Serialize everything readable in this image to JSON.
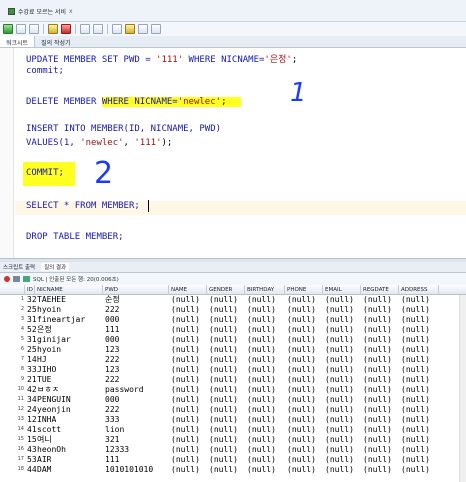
{
  "window": {
    "tab_title": "수강료 모르는 서비",
    "tab_close": "x"
  },
  "subtabs": [
    "워크시트",
    "질의 작성기"
  ],
  "editor": {
    "lines": {
      "update_kw": "UPDATE MEMBER SET PWD = ",
      "update_val": "'111'",
      "update_where": " WHERE NICNAME=",
      "update_nick": "'은정'",
      "update_end": ";",
      "commit1": "commit;",
      "delete_kw": "DELETE MEMBER ",
      "delete_where": "WHERE NICNAME=",
      "delete_val": "'newlec'",
      "delete_end": ";",
      "insert1": "INSERT INTO MEMBER(ID, NICNAME, PWD)",
      "insert2_kw": "VALUES(1, ",
      "insert2_a": "'newlec'",
      "insert2_b": ", ",
      "insert2_c": "'111'",
      "insert2_end": ");",
      "commit2": "COMMIT;",
      "select": "SELECT * FROM MEMBER;",
      "drop": "DROP TABLE MEMBER;"
    },
    "annotations": {
      "one": "1",
      "two": "2"
    }
  },
  "results": {
    "tabs": [
      "스크립트 출력",
      "질의 결과"
    ],
    "status": "SQL | 인출된 모든 행: 20(0.006초)",
    "columns": [
      "ID",
      "NICNAME",
      "PWD",
      "NAME",
      "GENDER",
      "BIRTHDAY",
      "PHONE",
      "EMAIL",
      "REGDATE",
      "ADDRESS"
    ],
    "rows": [
      {
        "n": "1",
        "id": "32",
        "nick": "TAEHEE",
        "pwd": "순정"
      },
      {
        "n": "2",
        "id": "25",
        "nick": "hyoin",
        "pwd": "222"
      },
      {
        "n": "3",
        "id": "31",
        "nick": "fineartjar",
        "pwd": "000"
      },
      {
        "n": "4",
        "id": "52",
        "nick": "은정",
        "pwd": "111"
      },
      {
        "n": "5",
        "id": "31",
        "nick": "ginijar",
        "pwd": "000"
      },
      {
        "n": "6",
        "id": "25",
        "nick": "hyoin",
        "pwd": "123"
      },
      {
        "n": "7",
        "id": "14",
        "nick": "HJ",
        "pwd": "222"
      },
      {
        "n": "8",
        "id": "33",
        "nick": "JIHO",
        "pwd": "123"
      },
      {
        "n": "9",
        "id": "21",
        "nick": "TUE",
        "pwd": "222"
      },
      {
        "n": "10",
        "id": "42",
        "nick": "ㅂㅎㅈ",
        "pwd": "password"
      },
      {
        "n": "11",
        "id": "34",
        "nick": "PENGUIN",
        "pwd": "000"
      },
      {
        "n": "12",
        "id": "24",
        "nick": "yeonjin",
        "pwd": "222"
      },
      {
        "n": "13",
        "id": "12",
        "nick": "INHA",
        "pwd": "333"
      },
      {
        "n": "14",
        "id": "41",
        "nick": "scott",
        "pwd": "lion"
      },
      {
        "n": "15",
        "id": "15",
        "nick": "여니",
        "pwd": "321"
      },
      {
        "n": "16",
        "id": "43",
        "nick": "heonOh",
        "pwd": "12333"
      },
      {
        "n": "17",
        "id": "53",
        "nick": "AIR",
        "pwd": "111"
      },
      {
        "n": "18",
        "id": "44",
        "nick": "DAM",
        "pwd": "1010101010"
      }
    ],
    "null_text": "(null)"
  }
}
